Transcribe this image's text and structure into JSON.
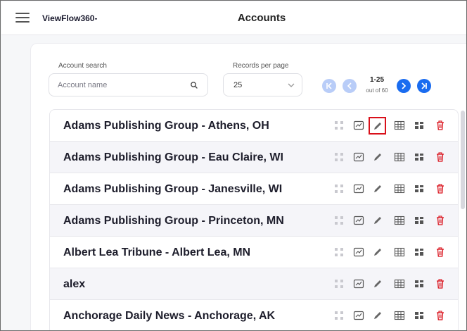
{
  "app": {
    "brand": "ViewFlow360-",
    "title": "Accounts"
  },
  "search": {
    "label": "Account search",
    "placeholder": "Account name"
  },
  "records_per_page": {
    "label": "Records per page",
    "value": "25"
  },
  "pagination": {
    "range": "1-25",
    "total": "out of 60"
  },
  "colors": {
    "accent": "#1a6cf0",
    "accent_disabled": "#b9cdf8",
    "danger": "#d9101a"
  },
  "accounts": [
    {
      "name": "Adams Publishing Group - Athens, OH"
    },
    {
      "name": "Adams Publishing Group - Eau Claire, WI"
    },
    {
      "name": "Adams Publishing Group - Janesville, WI"
    },
    {
      "name": "Adams Publishing Group - Princeton, MN"
    },
    {
      "name": "Albert Lea Tribune - Albert Lea, MN"
    },
    {
      "name": "alex"
    },
    {
      "name": "Anchorage Daily News - Anchorage, AK"
    }
  ],
  "row_actions": [
    "hierarchy-icon",
    "chart-icon",
    "edit-icon",
    "grid-icon",
    "dashboard-icon",
    "delete-icon"
  ]
}
